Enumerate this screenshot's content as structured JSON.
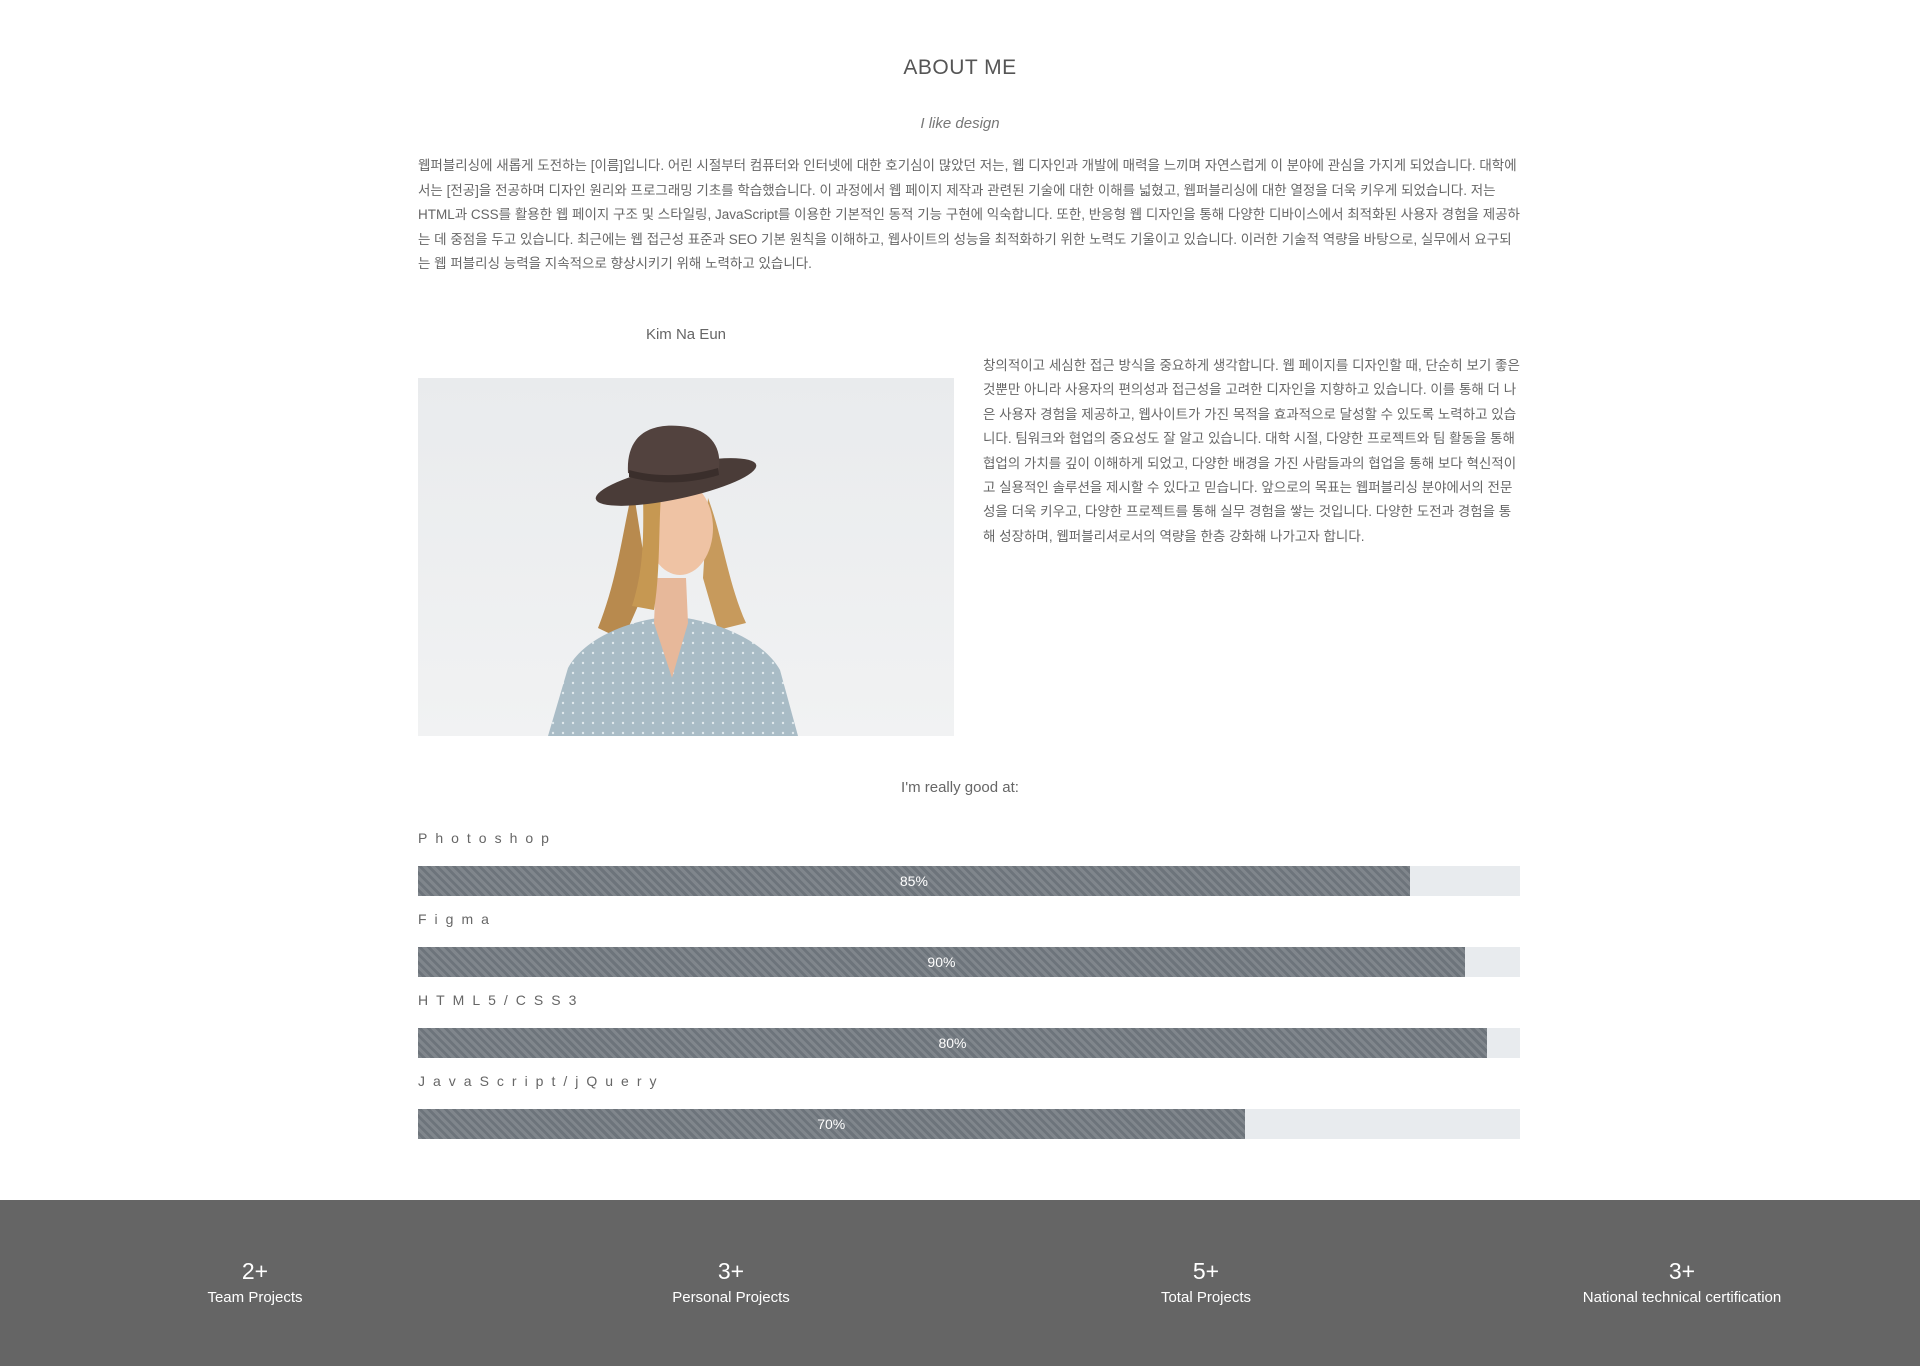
{
  "about": {
    "title": "ABOUT ME",
    "subtitle": "I like design",
    "intro": "웹퍼블리싱에 새롭게 도전하는 [이름]입니다. 어린 시절부터 컴퓨터와 인터넷에 대한 호기심이 많았던 저는, 웹 디자인과 개발에 매력을 느끼며 자연스럽게 이 분야에 관심을 가지게 되었습니다. 대학에서는 [전공]을 전공하며 디자인 원리와 프로그래밍 기초를 학습했습니다. 이 과정에서 웹 페이지 제작과 관련된 기술에 대한 이해를 넓혔고, 웹퍼블리싱에 대한 열정을 더욱 키우게 되었습니다. 저는 HTML과 CSS를 활용한 웹 페이지 구조 및 스타일링, JavaScript를 이용한 기본적인 동적 기능 구현에 익숙합니다. 또한, 반응형 웹 디자인을 통해 다양한 디바이스에서 최적화된 사용자 경험을 제공하는 데 중점을 두고 있습니다. 최근에는 웹 접근성 표준과 SEO 기본 원칙을 이해하고, 웹사이트의 성능을 최적화하기 위한 노력도 기울이고 있습니다. 이러한 기술적 역량을 바탕으로, 실무에서 요구되는 웹 퍼블리싱 능력을 지속적으로 향상시키기 위해 노력하고 있습니다.",
    "name": "Kim Na Eun",
    "bio": "창의적이고 세심한 접근 방식을 중요하게 생각합니다. 웹 페이지를 디자인할 때, 단순히 보기 좋은 것뿐만 아니라 사용자의 편의성과 접근성을 고려한 디자인을 지향하고 있습니다. 이를 통해 더 나은 사용자 경험을 제공하고, 웹사이트가 가진 목적을 효과적으로 달성할 수 있도록 노력하고 있습니다. 팀워크와 협업의 중요성도 잘 알고 있습니다. 대학 시절, 다양한 프로젝트와 팀 활동을 통해 협업의 가치를 깊이 이해하게 되었고, 다양한 배경을 가진 사람들과의 협업을 통해 보다 혁신적이고 실용적인 솔루션을 제시할 수 있다고 믿습니다. 앞으로의 목표는 웹퍼블리싱 분야에서의 전문성을 더욱 키우고, 다양한 프로젝트를 통해 실무 경험을 쌓는 것입니다. 다양한 도전과 경험을 통해 성장하며, 웹퍼블리셔로서의 역량을 한층 강화해 나가고자 합니다."
  },
  "skills": {
    "heading": "I'm really good at:",
    "items": [
      {
        "name": "Photoshop",
        "label": "85%",
        "value": 0.9
      },
      {
        "name": "Figma",
        "label": "90%",
        "value": 0.95
      },
      {
        "name": "HTML5/CSS3",
        "label": "80%",
        "value": 0.97
      },
      {
        "name": "JavaScript/jQuery",
        "label": "70%",
        "value": 0.75
      }
    ],
    "bar_color": "#6d747b",
    "track_color": "#e8ebee"
  },
  "footer": {
    "background": "#656565",
    "stats": [
      {
        "value": "2+",
        "label": "Team Projects"
      },
      {
        "value": "3+",
        "label": "Personal Projects"
      },
      {
        "value": "5+",
        "label": "Total Projects"
      },
      {
        "value": "3+",
        "label": "National technical certification"
      }
    ]
  }
}
